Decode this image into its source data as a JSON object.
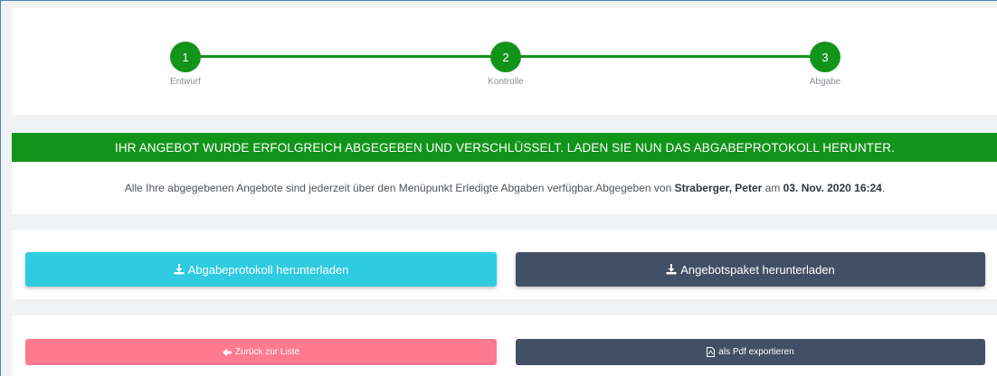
{
  "stepper": {
    "steps": [
      {
        "number": "1",
        "label": "Entwurf"
      },
      {
        "number": "2",
        "label": "Kontrolle"
      },
      {
        "number": "3",
        "label": "Abgabe"
      }
    ],
    "accent_color": "#12941a"
  },
  "banner": {
    "text": "IHR ANGEBOT WURDE ERFOLGREICH ABGEGEBEN UND VERSCHLÜSSELT. LADEN SIE NUN DAS ABGABEPROTOKOLL HERUNTER."
  },
  "info": {
    "prefix": "Alle Ihre abgegebenen Angebote sind jederzeit über den Menüpunkt Erledigte Abgaben verfügbar.Abgegeben von ",
    "submitter": "Straberger, Peter",
    "middle": " am ",
    "datetime": "03. Nov. 2020 16:24",
    "suffix": "."
  },
  "downloads": {
    "protocol_label": "Abgabeprotokoll herunterladen",
    "package_label": "Angebotspaket herunterladen",
    "icon": "download-icon"
  },
  "actions": {
    "back_label": "Zurück zur Liste",
    "back_icon": "arrow-left-icon",
    "pdf_label": "als Pdf exportieren",
    "pdf_icon": "pdf-file-icon"
  },
  "colors": {
    "success": "#12941a",
    "cyan": "#2ecbe1",
    "dark": "#434f64",
    "pink": "#ff7a8e"
  }
}
